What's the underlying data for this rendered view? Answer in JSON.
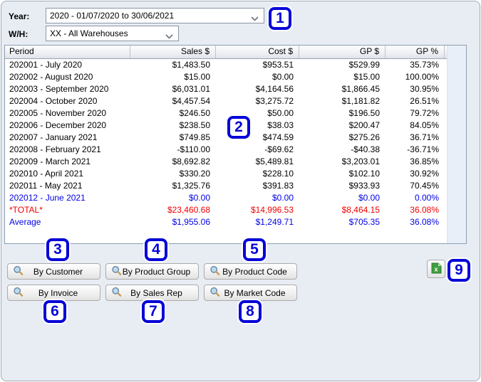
{
  "filters": {
    "year": {
      "label": "Year:",
      "value": "2020 - 01/07/2020 to 30/06/2021"
    },
    "warehouse": {
      "label": "W/H:",
      "value": "XX - All Warehouses"
    }
  },
  "table": {
    "columns": [
      "Period",
      "Sales $",
      "Cost $",
      "GP $",
      "GP %"
    ],
    "rows": [
      {
        "period": "202001 - July 2020",
        "sales": "$1,483.50",
        "cost": "$953.51",
        "gp": "$529.99",
        "gp_pct": "35.73%",
        "style": "normal"
      },
      {
        "period": "202002 - August 2020",
        "sales": "$15.00",
        "cost": "$0.00",
        "gp": "$15.00",
        "gp_pct": "100.00%",
        "style": "normal"
      },
      {
        "period": "202003 - September 2020",
        "sales": "$6,031.01",
        "cost": "$4,164.56",
        "gp": "$1,866.45",
        "gp_pct": "30.95%",
        "style": "normal"
      },
      {
        "period": "202004 - October 2020",
        "sales": "$4,457.54",
        "cost": "$3,275.72",
        "gp": "$1,181.82",
        "gp_pct": "26.51%",
        "style": "normal"
      },
      {
        "period": "202005 - November 2020",
        "sales": "$246.50",
        "cost": "$50.00",
        "gp": "$196.50",
        "gp_pct": "79.72%",
        "style": "normal"
      },
      {
        "period": "202006 - December 2020",
        "sales": "$238.50",
        "cost": "$38.03",
        "gp": "$200.47",
        "gp_pct": "84.05%",
        "style": "normal"
      },
      {
        "period": "202007 - January 2021",
        "sales": "$749.85",
        "cost": "$474.59",
        "gp": "$275.26",
        "gp_pct": "36.71%",
        "style": "normal"
      },
      {
        "period": "202008 - February 2021",
        "sales": "-$110.00",
        "cost": "-$69.62",
        "gp": "-$40.38",
        "gp_pct": "-36.71%",
        "style": "normal"
      },
      {
        "period": "202009 - March 2021",
        "sales": "$8,692.82",
        "cost": "$5,489.81",
        "gp": "$3,203.01",
        "gp_pct": "36.85%",
        "style": "normal"
      },
      {
        "period": "202010 - April 2021",
        "sales": "$330.20",
        "cost": "$228.10",
        "gp": "$102.10",
        "gp_pct": "30.92%",
        "style": "normal"
      },
      {
        "period": "202011 - May 2021",
        "sales": "$1,325.76",
        "cost": "$391.83",
        "gp": "$933.93",
        "gp_pct": "70.45%",
        "style": "normal"
      },
      {
        "period": "202012 - June 2021",
        "sales": "$0.00",
        "cost": "$0.00",
        "gp": "$0.00",
        "gp_pct": "0.00%",
        "style": "blue"
      },
      {
        "period": "*TOTAL*",
        "sales": "$23,460.68",
        "cost": "$14,996.53",
        "gp": "$8,464.15",
        "gp_pct": "36.08%",
        "style": "red"
      },
      {
        "period": "Average",
        "sales": "$1,955.06",
        "cost": "$1,249.71",
        "gp": "$705.35",
        "gp_pct": "36.08%",
        "style": "blue"
      }
    ]
  },
  "buttons": {
    "row1": [
      {
        "label": "By Customer"
      },
      {
        "label": "By Product Group"
      },
      {
        "label": "By Product Code"
      }
    ],
    "row2": [
      {
        "label": "By Invoice"
      },
      {
        "label": "By Sales Rep"
      },
      {
        "label": "By Market Code"
      }
    ]
  },
  "icons": {
    "drill_button": "magnifier-icon",
    "export": "excel-icon",
    "dropdown": "chevron-down-icon"
  },
  "callouts": [
    "1",
    "2",
    "3",
    "4",
    "5",
    "6",
    "7",
    "8",
    "9"
  ],
  "colors": {
    "panel_background": "#E8EDF4",
    "total_red": "#F20000",
    "highlight_blue": "#0000E6",
    "callout_blue": "#0404D8",
    "excel_green": "#3F9E3F"
  }
}
